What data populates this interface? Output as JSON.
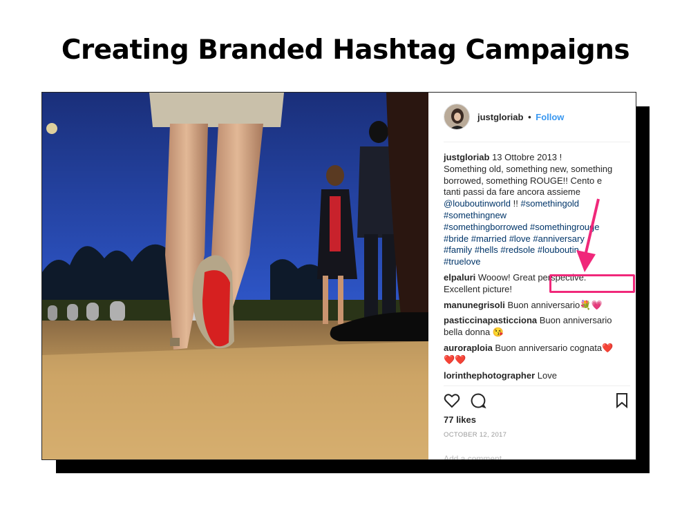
{
  "title": "Creating Branded Hashtag Campaigns",
  "post": {
    "username": "justgloriab",
    "follow_label": "Follow",
    "caption": {
      "username": "justgloriab",
      "line1": " 13 Ottobre 2013 !",
      "line2": "Something old, something new, something",
      "line3": "borrowed, something ROUGE!! Cento e",
      "line4": "tanti passi da fare ancora assieme",
      "mention": "@louboutinworld",
      "after_mention": " !! ",
      "hashtags": [
        "#somethingold",
        "#somethingnew",
        "#somethingborrowed",
        "#somethingrouge",
        "#bride",
        "#married",
        "#love",
        "#anniversary",
        "#family",
        "#hells",
        "#redsole",
        "#louboutin",
        "#truelove"
      ]
    },
    "comments": [
      {
        "user": "elpaluri",
        "text": " Wooow! Great perspective.",
        "text2": "Excellent picture!"
      },
      {
        "user": "manunegrisoli",
        "text": " Buon anniversario💐💗"
      },
      {
        "user": "pasticcinapasticciona",
        "text": " Buon anniversario",
        "text2": "bella donna 😘"
      },
      {
        "user": "auroraploia",
        "text": " Buon anniversario cognata❤️",
        "text2": "❤️❤️"
      },
      {
        "user": "lorinthephotographer",
        "text": " Love"
      }
    ],
    "likes": "77 likes",
    "date": "OCTOBER 12, 2017",
    "add_comment_placeholder": "Add a comment..."
  },
  "colors": {
    "highlight": "#f0287a",
    "link": "#003569",
    "follow": "#3897f0"
  },
  "icons": [
    "heart-icon",
    "comment-icon",
    "bookmark-icon",
    "arrow-icon"
  ]
}
